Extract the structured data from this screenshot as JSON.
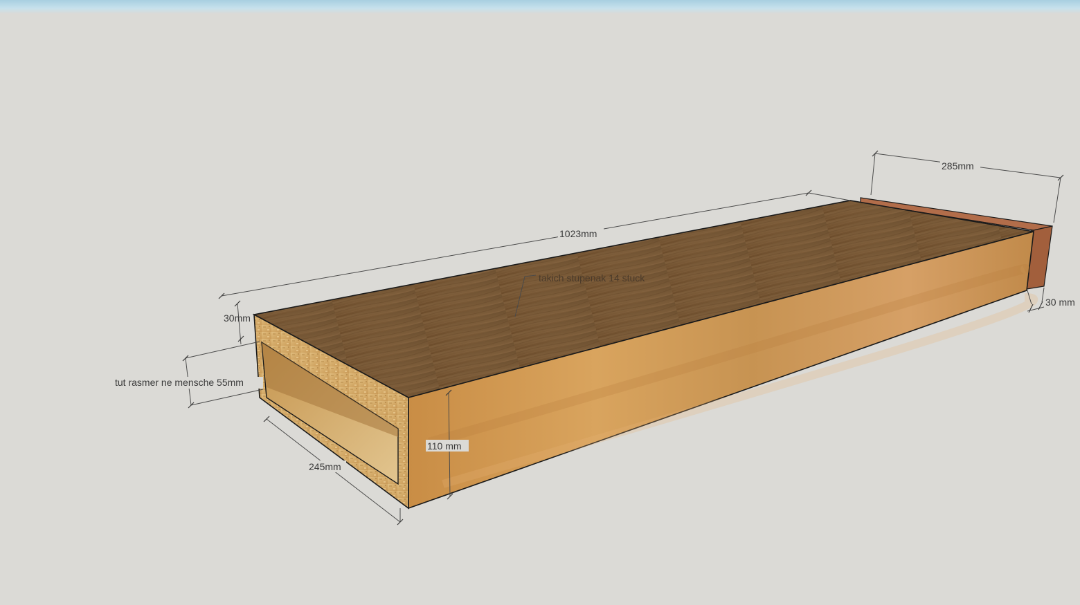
{
  "viewport": {
    "background_color": "#dbdad6",
    "sky_color": "#b6d8e6"
  },
  "model": {
    "materials": {
      "top_color_light": "#8a6a45",
      "top_color_dark": "#5e4326",
      "front_color_light": "#d7a158",
      "front_color_dark": "#b07838",
      "osb_color": "#d9b277",
      "osb_dark": "#b98d4c",
      "riser_color": "#b87350",
      "riser_dark": "#8e4f33"
    }
  },
  "annotations": {
    "length": "1023mm",
    "riser_depth": "285mm",
    "top_thickness": "30mm",
    "riser_thickness": "30 mm",
    "note_gap": "tut rasmer ne mensche 55mm",
    "depth": "245mm",
    "height": "110 mm",
    "note_quantity": "takich stupenak 14 stuck"
  }
}
